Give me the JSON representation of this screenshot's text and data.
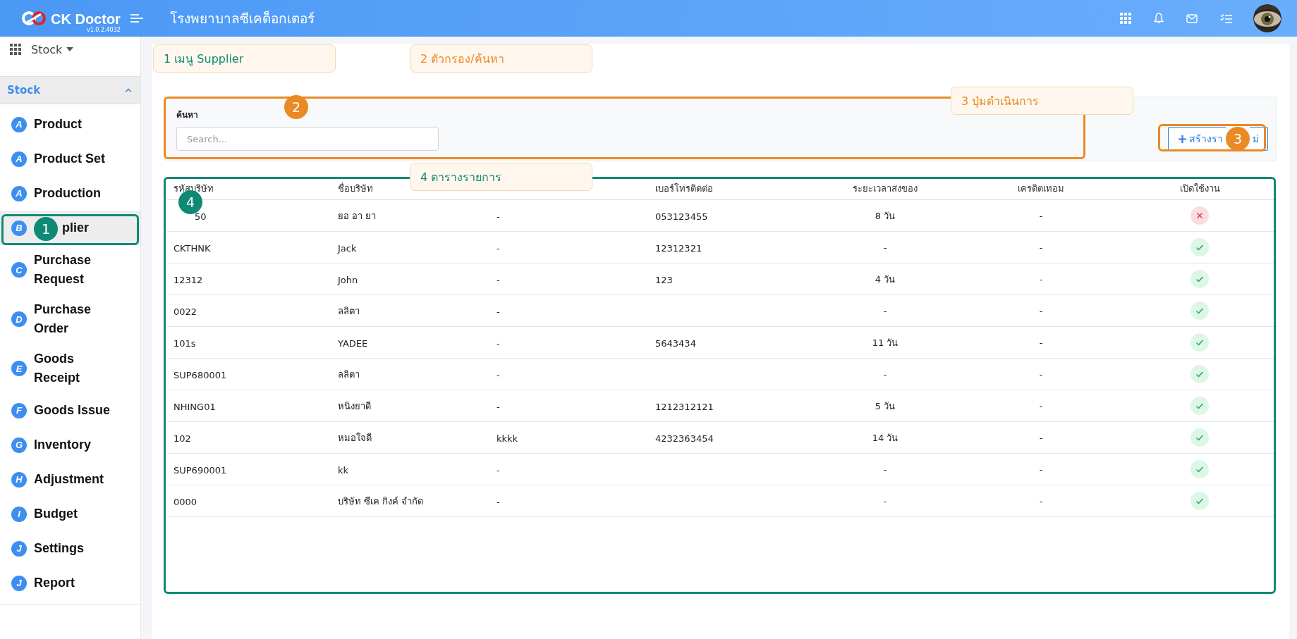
{
  "header": {
    "app_name": "CK Doctor",
    "version": "v1.0.2.4032",
    "hospital": "โรงพยาบาลซีเคด็อกเตอร์"
  },
  "sidebar": {
    "module": "Stock",
    "section": {
      "title": "Stock",
      "expanded": true
    },
    "items": [
      {
        "letter": "A",
        "label": "Product",
        "selected": false
      },
      {
        "letter": "A",
        "label": "Product Set",
        "selected": false
      },
      {
        "letter": "A",
        "label": "Production",
        "selected": false
      },
      {
        "letter": "B",
        "label": "plier",
        "selected": true
      },
      {
        "letter": "C",
        "label": "Purchase Request",
        "selected": false
      },
      {
        "letter": "D",
        "label": "Purchase Order",
        "selected": false
      },
      {
        "letter": "E",
        "label": "Goods Receipt",
        "selected": false
      },
      {
        "letter": "F",
        "label": "Goods Issue",
        "selected": false
      },
      {
        "letter": "G",
        "label": "Inventory",
        "selected": false
      },
      {
        "letter": "H",
        "label": "Adjustment",
        "selected": false
      },
      {
        "letter": "I",
        "label": "Budget",
        "selected": false
      },
      {
        "letter": "J",
        "label": "Settings",
        "selected": false
      },
      {
        "letter": "J",
        "label": "Report",
        "selected": false
      }
    ]
  },
  "filter": {
    "label": "ค้นหา",
    "placeholder": "Search..."
  },
  "create_button": {
    "label": "สร้างรา",
    "label_end": "ม่"
  },
  "table": {
    "headers": {
      "code": "รหัสบริษัท",
      "name": "ชื่อบริษัท",
      "phone": "เบอร์โทรติดต่อ",
      "lead_time": "ระยะเวลาส่งของ",
      "credit_term": "เครดิตเทอม",
      "active": "เปิดใช้งาน"
    },
    "rows": [
      {
        "code": "50",
        "name": "ยอ อา ยา",
        "column_3": "-",
        "phone": "053123455",
        "lead_time": "8 วัน",
        "credit_term": "-",
        "active": false
      },
      {
        "code": "CKTHNK",
        "name": "Jack",
        "column_3": "-",
        "phone": "12312321",
        "lead_time": "-",
        "credit_term": "-",
        "active": true
      },
      {
        "code": "12312",
        "name": "John",
        "column_3": "-",
        "phone": "123",
        "lead_time": "4 วัน",
        "credit_term": "-",
        "active": true
      },
      {
        "code": "0022",
        "name": "ลลิตา",
        "column_3": "-",
        "lead_time": "-",
        "credit_term": "-",
        "active": true
      },
      {
        "code": "101s",
        "name": "YADEE",
        "column_3": "-",
        "phone": "5643434",
        "lead_time": "11 วัน",
        "credit_term": "-",
        "active": true
      },
      {
        "code": "SUP680001",
        "name": "ลลิตา",
        "column_3": "-",
        "lead_time": "-",
        "credit_term": "-",
        "active": true
      },
      {
        "code": "NHING01",
        "name": "หนิงยาดี",
        "column_3": "-",
        "phone": "1212312121",
        "lead_time": "5 วัน",
        "credit_term": "-",
        "active": true
      },
      {
        "code": "102",
        "name": "หมอใจดี",
        "column_3": "kkkk",
        "phone": "4232363454",
        "lead_time": "14 วัน",
        "credit_term": "-",
        "active": true
      },
      {
        "code": "SUP690001",
        "name": "kk",
        "column_3": "-",
        "lead_time": "-",
        "credit_term": "-",
        "active": true
      },
      {
        "code": "0000",
        "name": "บริษัท ซีเค กิงค์ จำกัด",
        "column_3": "-",
        "lead_time": "-",
        "credit_term": "-",
        "active": true
      }
    ]
  },
  "annotations": [
    {
      "badge": "1",
      "callout": "1 เมนู Supplier",
      "color": "#0e8a74"
    },
    {
      "badge": "2",
      "callout": "2 ตัวกรอง/ค้นหา",
      "color": "#e98a25"
    },
    {
      "badge": "3",
      "callout": "3 ปุ่มดำเนินการ",
      "color": "#e98a25"
    },
    {
      "badge": "4",
      "callout": "4 ตารางรายการ",
      "color": "#0e8a74"
    }
  ]
}
